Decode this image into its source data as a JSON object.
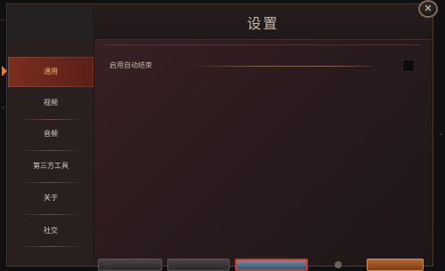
{
  "dialog": {
    "title": "设置",
    "close_label": "✕"
  },
  "sidebar": {
    "items": [
      {
        "label": "通用",
        "active": true
      },
      {
        "label": "视频",
        "active": false
      },
      {
        "label": "音频",
        "active": false
      },
      {
        "label": "第三方工具",
        "active": false
      },
      {
        "label": "关于",
        "active": false
      },
      {
        "label": "社交",
        "active": false
      }
    ]
  },
  "general": {
    "options": [
      {
        "label": "启用自动结束",
        "checked": false
      }
    ]
  },
  "colors": {
    "accent": "#e57b45",
    "active_tab": "#7a2e1f",
    "highlight_border": "#d23b2a"
  }
}
